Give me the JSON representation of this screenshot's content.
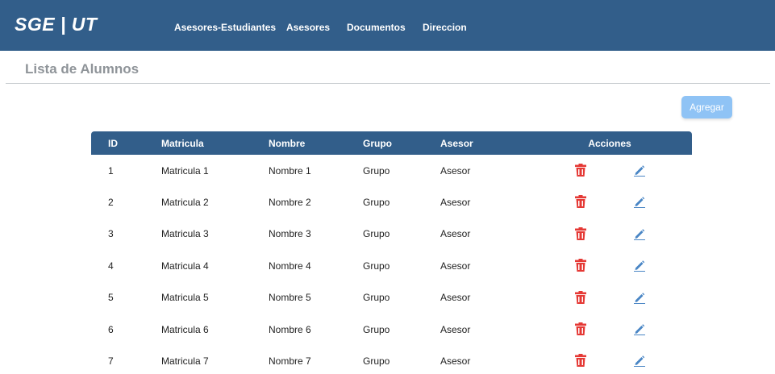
{
  "app": {
    "brand": "SGE | UT"
  },
  "nav": {
    "items": [
      "Asesores-Estudiantes",
      "Asesores",
      "Documentos",
      "Direccion"
    ]
  },
  "page": {
    "title": "Lista de Alumnos",
    "add_label": "Agregar"
  },
  "table": {
    "headers": [
      "ID",
      "Matricula",
      "Nombre",
      "Grupo",
      "Asesor",
      "Acciones"
    ],
    "rows": [
      {
        "id": "1",
        "matricula": "Matricula 1",
        "nombre": "Nombre 1",
        "grupo": "Grupo",
        "asesor": "Asesor"
      },
      {
        "id": "2",
        "matricula": "Matricula 2",
        "nombre": "Nombre 2",
        "grupo": "Grupo",
        "asesor": "Asesor"
      },
      {
        "id": "3",
        "matricula": "Matricula 3",
        "nombre": "Nombre 3",
        "grupo": "Grupo",
        "asesor": "Asesor"
      },
      {
        "id": "4",
        "matricula": "Matricula 4",
        "nombre": "Nombre 4",
        "grupo": "Grupo",
        "asesor": "Asesor"
      },
      {
        "id": "5",
        "matricula": "Matricula 5",
        "nombre": "Nombre 5",
        "grupo": "Grupo",
        "asesor": "Asesor"
      },
      {
        "id": "6",
        "matricula": "Matricula 6",
        "nombre": "Nombre 6",
        "grupo": "Grupo",
        "asesor": "Asesor"
      },
      {
        "id": "7",
        "matricula": "Matricula 7",
        "nombre": "Nombre 7",
        "grupo": "Grupo",
        "asesor": "Asesor"
      }
    ],
    "action_icons": [
      "trash-icon",
      "pencil-icon"
    ]
  },
  "colors": {
    "primary": "#325e8a",
    "button": "#8fc3f5",
    "delete": "#e53935",
    "edit": "#4a86c5",
    "muted_title": "#8f9499"
  }
}
